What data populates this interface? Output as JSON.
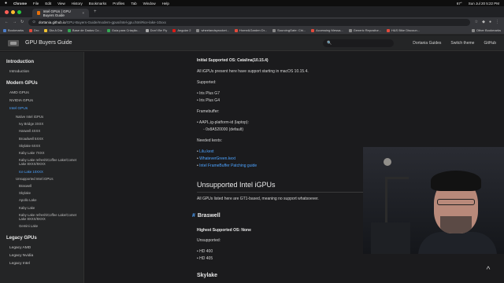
{
  "menubar": {
    "app": "Chrome",
    "items": [
      "File",
      "Edit",
      "View",
      "History",
      "Bookmarks",
      "Profiles",
      "Tab",
      "Window",
      "Help"
    ],
    "right": [
      "67°",
      "Sun Jul 20 5:22 PM"
    ]
  },
  "tab": {
    "title": "Intel GPUs | GPU Buyers Guide",
    "close": "×",
    "new": "+"
  },
  "address": {
    "host": "dortania.github.io",
    "path": "/GPU-Buyers-Guide/modern-gpus/intel-gpu.html#ice-lake-10xxx"
  },
  "bookmarks": [
    "Bookmarks",
    "Dro",
    "Dia A Dia",
    "Base de Dados Co...",
    "Guia para Criação...",
    "Don't Be Fly",
    "Angular 2",
    "wheelandsprocket...",
    "Home&Garden Dr...",
    "SourcingGate: Chi...",
    "Accessing Messa...",
    "Generic Repositor...",
    "H&S Bike Discoun..."
  ],
  "bookmarks_other": "Other Bookmarks",
  "site": {
    "title": "GPU Buyers Guide",
    "search_placeholder": "🔍",
    "links": [
      "Dortania Guides",
      "Switch theme",
      "GitHub"
    ]
  },
  "sidebar": {
    "sections": [
      {
        "head": "Introduction",
        "items": [
          "Introduction"
        ]
      },
      {
        "head": "Modern GPUs",
        "items": [
          "AMD GPUs",
          "NVIDIA GPUs",
          "Intel GPUs"
        ]
      }
    ],
    "intel_sub": [
      "Native Intel iGPUs"
    ],
    "intel_native": [
      "Ivy Bridge 3XXX",
      "Haswell 4XXX",
      "Broadwell 5XXX",
      "Skylake 6XXX",
      "Kaby Lake 7XXX",
      "Kaby Lake refresh/Coffee Lake/Comet Lake 8XXX/9XXX",
      "Ice Lake 10XXX"
    ],
    "unsupported_head": "Unsupported Intel iGPUs",
    "unsupported": [
      "Braswell",
      "Skylake",
      "Apollo Lake",
      "Kaby Lake",
      "Kaby Lake refresh/Coffee Lake/Comet Lake 8XXX/9XXX",
      "Gemini Lake"
    ],
    "legacy_head": "Legacy GPUs",
    "legacy": [
      "Legacy AMD",
      "Legacy Nvidia",
      "Legacy Intel"
    ]
  },
  "content": {
    "initial_os": "Initial Supported OS: Catalina(10.15.4)",
    "all_present": "All iGPUs present here have support starting in macOS 10.15.4.",
    "supported": "Supported:",
    "supported_list": [
      "Iris Plus G7",
      "Iris Plus G4"
    ],
    "framebuffer": "Framebuffer:",
    "framebuffer_item": "AAPL,ig-platform-id (laptop):",
    "framebuffer_value": "0x8A520000 (default)",
    "kexts": "Needed kexts:",
    "kext_links": [
      "Lilu.kext",
      "WhateverGreen.kext",
      "Intel FrameBuffer Patching guide"
    ],
    "unsupported_title": "Unsupported Intel iGPUs",
    "unsupported_text": "All GPUs listed here are GT1-based, meaning no support whatsoever.",
    "braswell_title": "Braswell",
    "braswell_os": "Highest Supported OS: None",
    "braswell_unsupported": "Unsupported:",
    "braswell_list": [
      "HD 400",
      "HD 405"
    ],
    "skylake_title": "Skylake"
  },
  "scroll_top": "^"
}
